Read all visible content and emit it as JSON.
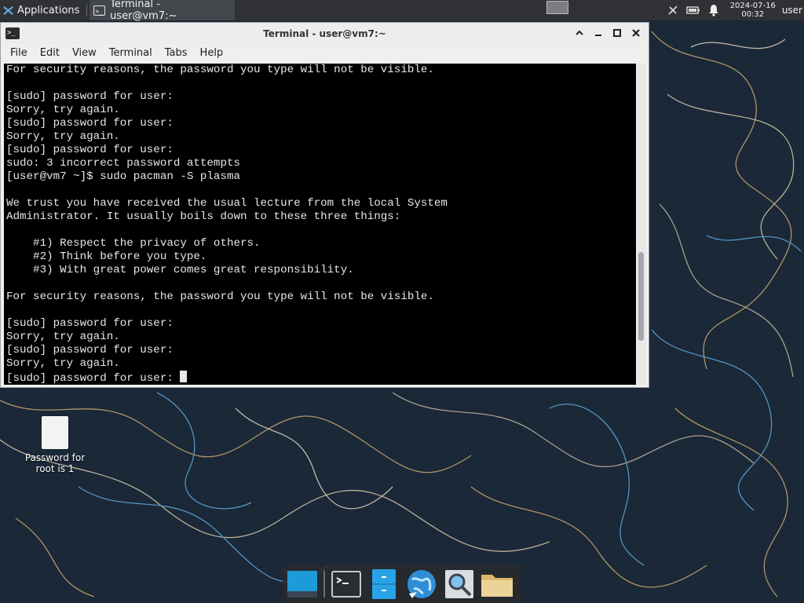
{
  "top_panel": {
    "applications_label": "Applications",
    "taskbar_window_title": "Terminal - user@vm7:~",
    "clock_date": "2024-07-16",
    "clock_time": "00:32",
    "user_label": "user",
    "tray_icons": [
      "network-disconnected-icon",
      "battery-icon",
      "notification-bell-icon"
    ]
  },
  "terminal_window": {
    "title": "Terminal - user@vm7:~",
    "menu": [
      "File",
      "Edit",
      "View",
      "Terminal",
      "Tabs",
      "Help"
    ],
    "lines": [
      "For security reasons, the password you type will not be visible.",
      "",
      "[sudo] password for user:",
      "Sorry, try again.",
      "[sudo] password for user:",
      "Sorry, try again.",
      "[sudo] password for user:",
      "sudo: 3 incorrect password attempts",
      "[user@vm7 ~]$ sudo pacman -S plasma",
      "",
      "We trust you have received the usual lecture from the local System",
      "Administrator. It usually boils down to these three things:",
      "",
      "    #1) Respect the privacy of others.",
      "    #2) Think before you type.",
      "    #3) With great power comes great responsibility.",
      "",
      "For security reasons, the password you type will not be visible.",
      "",
      "[sudo] password for user:",
      "Sorry, try again.",
      "[sudo] password for user:",
      "Sorry, try again."
    ],
    "prompt_line": "[sudo] password for user: ",
    "scroll_position": 0.72,
    "scroll_visible_fraction": 0.62
  },
  "desktop": {
    "icon_label": "Password for root is 1"
  },
  "dock": {
    "items": [
      "show-desktop-icon",
      "terminal-icon",
      "file-cabinet-icon",
      "web-browser-icon",
      "app-finder-icon",
      "folder-icon"
    ]
  },
  "colors": {
    "panel_bg": "#2f3134",
    "terminal_bg": "#000000",
    "terminal_fg": "#e6e6e6",
    "wallpaper_bg": "#1b2a3a"
  }
}
